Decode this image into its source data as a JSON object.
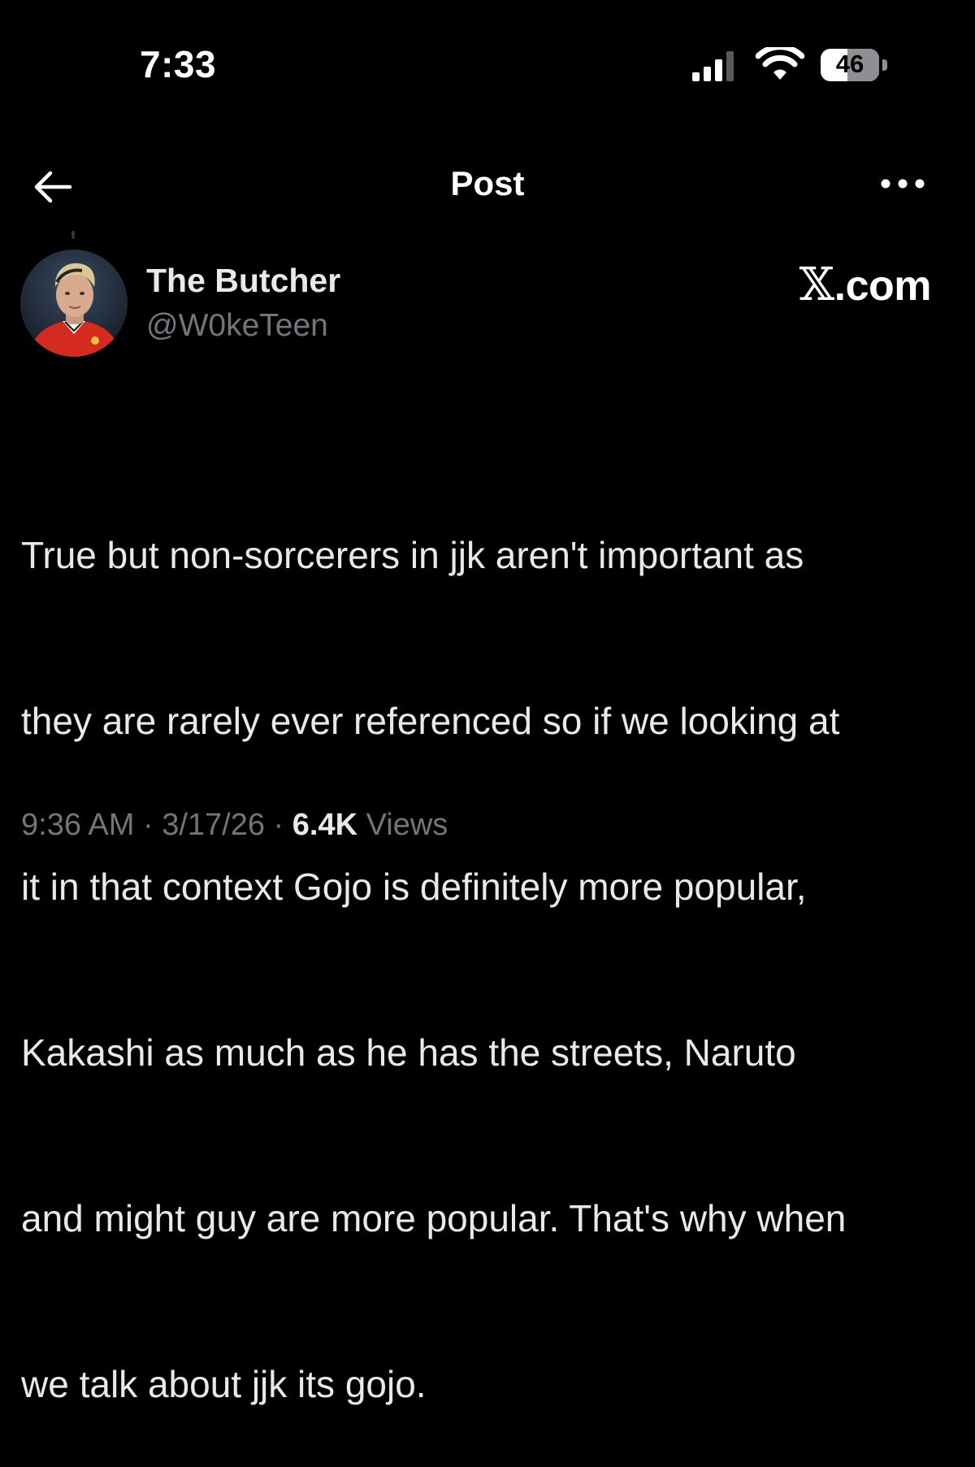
{
  "status_bar": {
    "time": "7:33",
    "battery_level": "46",
    "battery_fraction": 0.46,
    "signal_bars_filled": 3,
    "signal_bars_total": 4
  },
  "header": {
    "back_icon": "arrow-left-icon",
    "title": "Post",
    "more_icon": "ellipsis-icon"
  },
  "post": {
    "author": {
      "display_name": "The Butcher",
      "handle": "@W0keTeen"
    },
    "source_mark_x": "𝕏",
    "source_mark_rest": ".com",
    "lines": [
      "True but non-sorcerers in jjk aren't important as",
      "they are rarely ever referenced so if we looking at",
      "it in that context Gojo is definitely more popular,",
      "Kakashi as much as he has the streets, Naruto",
      "and might guy are more popular. That's why when",
      "we talk about jjk its gojo."
    ],
    "meta": {
      "time": "9:36 AM",
      "separator": " · ",
      "date": "3/17/26",
      "views_count": "6.4K",
      "views_label": " Views"
    }
  },
  "colors": {
    "background": "#000000",
    "primary_text": "#e7e9ea",
    "secondary_text": "#71767b"
  }
}
